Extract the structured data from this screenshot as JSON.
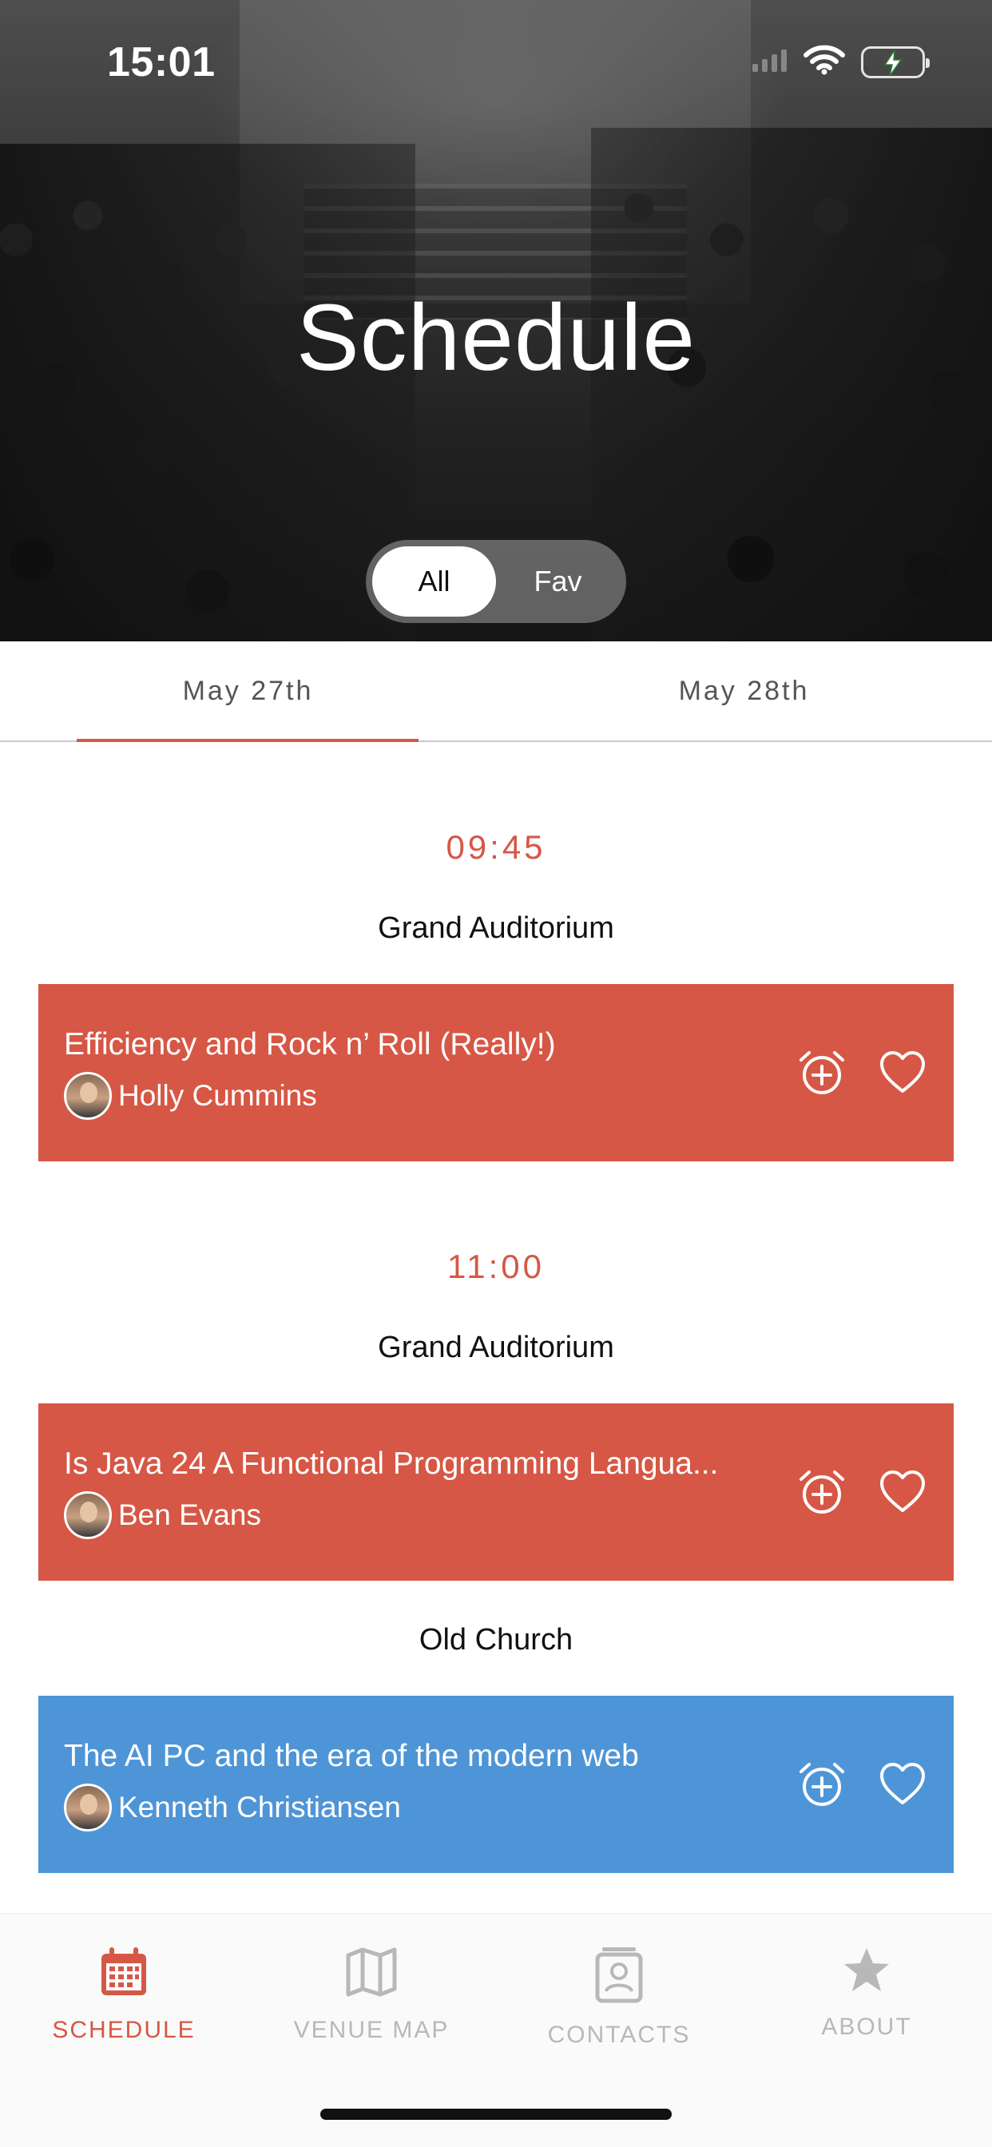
{
  "status_bar": {
    "time": "15:01"
  },
  "hero": {
    "title": "Schedule"
  },
  "filter": {
    "options": [
      "All",
      "Fav"
    ],
    "selected": "All"
  },
  "date_tabs": {
    "items": [
      "May 27th",
      "May 28th"
    ],
    "selected": "May 27th"
  },
  "schedule": {
    "slots": [
      {
        "time": "09:45",
        "venues": [
          {
            "name": "Grand Auditorium",
            "sessions": [
              {
                "title": "Efficiency and Rock n’ Roll (Really!)",
                "speaker": "Holly Cummins",
                "color": "#d65745"
              }
            ]
          }
        ]
      },
      {
        "time": "11:00",
        "venues": [
          {
            "name": "Grand Auditorium",
            "sessions": [
              {
                "title": "Is Java 24 A Functional Programming Langua...",
                "speaker": "Ben Evans",
                "color": "#d65745"
              }
            ]
          },
          {
            "name": "Old Church",
            "sessions": [
              {
                "title": "The AI PC and the era of the modern web",
                "speaker": "Kenneth Christiansen",
                "color": "#4e95d7"
              }
            ]
          }
        ]
      }
    ]
  },
  "tab_bar": {
    "items": [
      {
        "label": "SCHEDULE",
        "icon": "calendar-icon",
        "active": true
      },
      {
        "label": "VENUE MAP",
        "icon": "map-icon",
        "active": false
      },
      {
        "label": "CONTACTS",
        "icon": "contacts-icon",
        "active": false
      },
      {
        "label": "ABOUT",
        "icon": "star-icon",
        "active": false
      }
    ]
  },
  "colors": {
    "accent": "#d65745",
    "session_red": "#d65745",
    "session_blue": "#4e95d7",
    "inactive_tab": "#b8b8b8"
  }
}
